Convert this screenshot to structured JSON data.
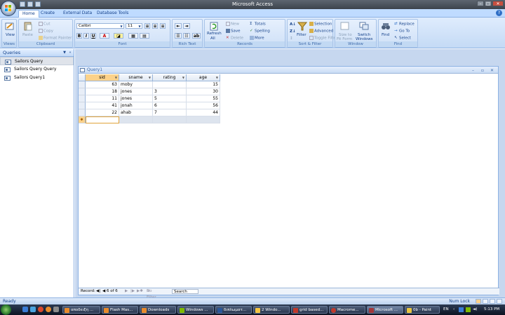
{
  "window": {
    "title": "Microsoft Access"
  },
  "tabs": [
    "Home",
    "Create",
    "External Data",
    "Database Tools"
  ],
  "ribbon": {
    "views": {
      "view_label": "View",
      "group_label": "Views"
    },
    "clipboard": {
      "paste": "Paste",
      "cut": "Cut",
      "copy": "Copy",
      "format_painter": "Format Painter",
      "group_label": "Clipboard"
    },
    "font": {
      "font_name": "Calibri",
      "font_size": "11",
      "bold": "B",
      "italic": "I",
      "underline": "U",
      "group_label": "Font"
    },
    "rich_text": {
      "group_label": "Rich Text"
    },
    "records": {
      "refresh": "Refresh",
      "refresh_sub": "All",
      "new": "New",
      "save": "Save",
      "delete": "Delete",
      "totals": "Totals",
      "spelling": "Spelling",
      "more": "More",
      "group_label": "Records"
    },
    "sort_filter": {
      "filter": "Filter",
      "selection": "Selection",
      "advanced": "Advanced",
      "toggle_filter": "Toggle Filter",
      "group_label": "Sort & Filter"
    },
    "window": {
      "size_to_fit": "Size to",
      "size_to_fit2": "Fit Form",
      "switch": "Switch",
      "switch2": "Windows",
      "group_label": "Window"
    },
    "find": {
      "find": "Find",
      "replace": "Replace",
      "goto": "Go To",
      "select": "Select",
      "group_label": "Find"
    }
  },
  "nav": {
    "header": "Queries",
    "items": [
      "Sailors Query",
      "Sailors Query Query",
      "Sailors Query1"
    ]
  },
  "document": {
    "title": "Query1"
  },
  "table": {
    "columns": [
      "sid",
      "sname",
      "rating",
      "age"
    ],
    "rows": [
      {
        "sid": "63",
        "sname": "moby",
        "rating": "",
        "age": "15"
      },
      {
        "sid": "18",
        "sname": "jones",
        "rating": "3",
        "age": "30"
      },
      {
        "sid": "11",
        "sname": "jones",
        "rating": "5",
        "age": "55"
      },
      {
        "sid": "41",
        "sname": "jonah",
        "rating": "6",
        "age": "56"
      },
      {
        "sid": "22",
        "sname": "ahab",
        "rating": "7",
        "age": "44"
      }
    ]
  },
  "record_nav": {
    "label": "Record:",
    "position": "6 of 6",
    "filter": "No Filter",
    "search": "Search"
  },
  "status": {
    "left": "Ready",
    "right": "Num Lock"
  },
  "taskbar": {
    "items": [
      "αποδειξη ...",
      "Flash Mas...",
      "Downloads",
      "Windows ...",
      "διπλωματ...",
      "2 Windo...",
      "grid based...",
      "Macrome...",
      "Microsoft ...",
      "0b - Paint"
    ],
    "lang": "EN",
    "clock": "5:13 PM"
  }
}
